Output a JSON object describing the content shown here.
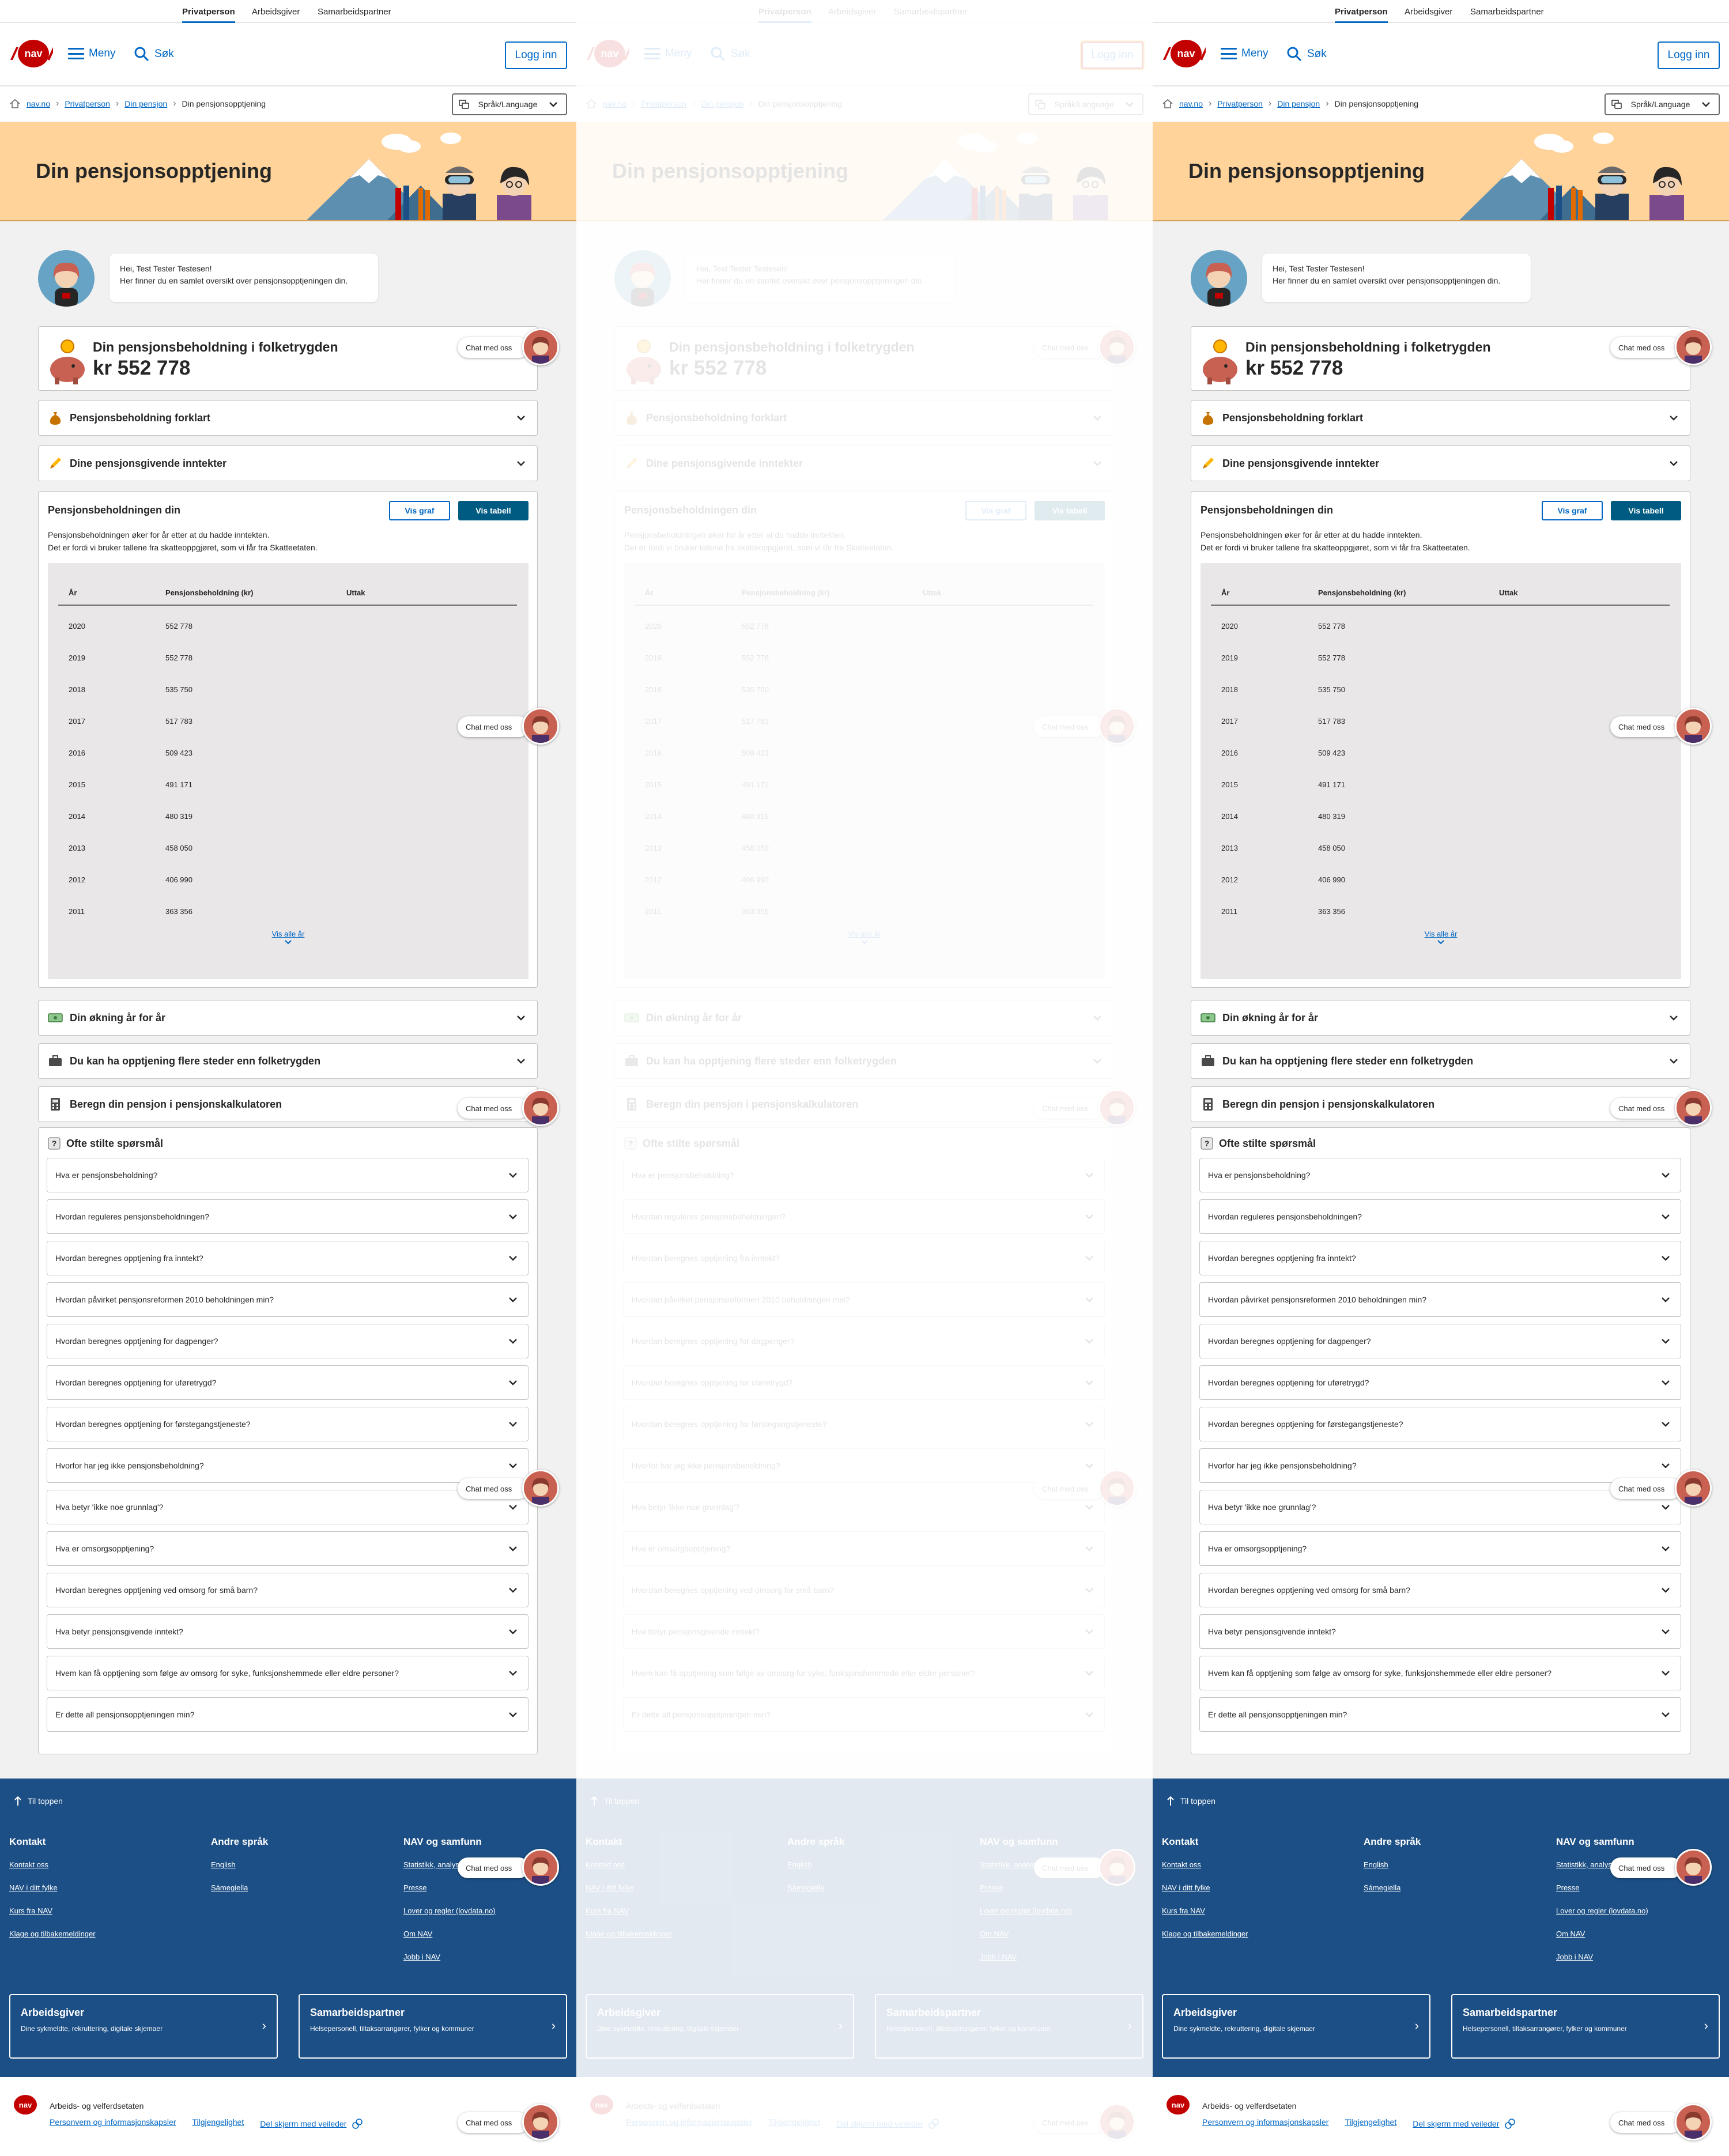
{
  "topnav": {
    "items": [
      "Privatperson",
      "Arbeidsgiver",
      "Samarbeidspartner"
    ]
  },
  "header": {
    "menu_label": "Meny",
    "search_label": "Søk",
    "login_label": "Logg inn",
    "logo_text": "nav"
  },
  "breadcrumb": {
    "items": [
      "nav.no",
      "Privatperson",
      "Din pensjon",
      "Din pensjonsopptjening"
    ]
  },
  "language": {
    "label": "Språk/Language"
  },
  "hero": {
    "title": "Din pensjonsopptjening"
  },
  "greeting": {
    "line1": "Hei, Test Tester Testesen!",
    "line2": "Her finner du en samlet oversikt over pensjonsopptjeningen din."
  },
  "balance": {
    "label": "Din pensjonsbeholdning i folketrygden",
    "amount": "kr 552 778"
  },
  "sections": {
    "explained": "Pensjonsbeholdning forklart",
    "income": "Dine pensjonsgivende inntekter",
    "increase": "Din økning år for år",
    "elsewhere": "Du kan ha opptjening flere steder enn folketrygden",
    "calculator": "Beregn din pensjon i pensjonskalkulatoren"
  },
  "table": {
    "title": "Pensjonsbeholdningen din",
    "desc1": "Pensjonsbeholdningen øker for år etter at du hadde inntekten.",
    "desc2": "Det er fordi vi bruker tallene fra skatteoppgjøret, som vi får fra Skatteetaten.",
    "btn_graph": "Vis graf",
    "btn_table": "Vis tabell",
    "headers": [
      "År",
      "Pensjonsbeholdning (kr)",
      "Uttak"
    ],
    "rows": [
      [
        "2020",
        "552 778"
      ],
      [
        "2019",
        "552 778"
      ],
      [
        "2018",
        "535 750"
      ],
      [
        "2017",
        "517 783"
      ],
      [
        "2016",
        "509 423"
      ],
      [
        "2015",
        "491 171"
      ],
      [
        "2014",
        "480 319"
      ],
      [
        "2013",
        "458 050"
      ],
      [
        "2012",
        "406 990"
      ],
      [
        "2011",
        "363 356"
      ]
    ],
    "show_all": "Vis alle år"
  },
  "faq": {
    "title": "Ofte stilte spørsmål",
    "items": [
      "Hva er pensjonsbeholdning?",
      "Hvordan reguleres pensjonsbeholdningen?",
      "Hvordan beregnes opptjening fra inntekt?",
      "Hvordan påvirket pensjonsreformen 2010 beholdningen min?",
      "Hvordan beregnes opptjening for dagpenger?",
      "Hvordan beregnes opptjening for uføretrygd?",
      "Hvordan beregnes opptjening for førstegangstjeneste?",
      "Hvorfor har jeg ikke pensjonsbeholdning?",
      "Hva betyr 'ikke noe grunnlag'?",
      "Hva er omsorgsopptjening?",
      "Hvordan beregnes opptjening ved omsorg for små barn?",
      "Hva betyr pensjonsgivende inntekt?",
      "Hvem kan få opptjening som følge av omsorg for syke, funksjonshemmede eller eldre personer?",
      "Er dette all pensjonsopptjeningen min?"
    ]
  },
  "chat": {
    "label": "Chat med oss"
  },
  "footer": {
    "to_top": "Til toppen",
    "contact": {
      "title": "Kontakt",
      "links": [
        "Kontakt oss",
        "NAV i ditt fylke",
        "Kurs fra NAV",
        "Klage og tilbakemeldinger"
      ]
    },
    "languages": {
      "title": "Andre språk",
      "links": [
        "English",
        "Sámegiella"
      ]
    },
    "society": {
      "title": "NAV og samfunn",
      "links": [
        "Statistikk, analyse og FoU",
        "Presse",
        "Lover og regler (lovdata.no)",
        "Om NAV",
        "Jobb i NAV"
      ]
    },
    "employer": {
      "title": "Arbeidsgiver",
      "sub": "Dine sykmeldte, rekruttering, digitale skjemaer"
    },
    "partner": {
      "title": "Samarbeidspartner",
      "sub": "Helsepersonell, tiltaksarrangører, fylker og kommuner"
    }
  },
  "bottom": {
    "org": "Arbeids- og velferdsetaten",
    "links": [
      "Personvern og informasjonskapsler",
      "Tilgjengelighet",
      "Del skjerm med veileder"
    ]
  },
  "colors": {
    "brand_red": "#c30000",
    "link_blue": "#0067c5",
    "hero_bg": "#ffd399",
    "footer_bg": "#1c4f85"
  }
}
